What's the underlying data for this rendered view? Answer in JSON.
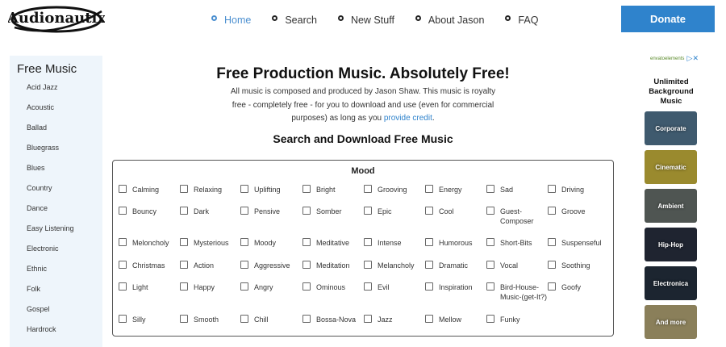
{
  "logo": {
    "text": "Audionautix"
  },
  "nav": {
    "items": [
      {
        "label": "Home",
        "active": true
      },
      {
        "label": "Search",
        "active": false
      },
      {
        "label": "New Stuff",
        "active": false
      },
      {
        "label": "About Jason",
        "active": false
      },
      {
        "label": "FAQ",
        "active": false
      }
    ],
    "donate_label": "Donate"
  },
  "sidebar": {
    "title": "Free Music",
    "items": [
      "Acid Jazz",
      "Acoustic",
      "Ballad",
      "Bluegrass",
      "Blues",
      "Country",
      "Dance",
      "Easy Listening",
      "Electronic",
      "Ethnic",
      "Folk",
      "Gospel",
      "Hardrock"
    ]
  },
  "main": {
    "title": "Free Production Music. Absolutely Free!",
    "desc_before": "All music is composed and produced by Jason Shaw. This music is royalty free - completely free - for you to download and use (even for commercial purposes) as long as you",
    "desc_link": "provide credit",
    "desc_after": ".",
    "section_title": "Search and Download Free Music"
  },
  "mood": {
    "title": "Mood",
    "options": [
      [
        "Calming",
        "Relaxing",
        "Uplifting",
        "Bright",
        "Grooving",
        "Energy",
        "Sad",
        "Driving"
      ],
      [
        "Bouncy",
        "Dark",
        "Pensive",
        "Somber",
        "Epic",
        "Cool",
        "Guest-Composer",
        "Groove"
      ],
      [
        "Meloncholy",
        "Mysterious",
        "Moody",
        "Meditative",
        "Intense",
        "Humorous",
        "Short-Bits",
        "Suspenseful"
      ],
      [
        "Christmas",
        "Action",
        "Aggressive",
        "Meditation",
        "Melancholy",
        "Dramatic",
        "Vocal",
        "Soothing"
      ],
      [
        "Light",
        "Happy",
        "Angry",
        "Ominous",
        "Evil",
        "Inspiration",
        "Bird-House-Music-(get-It?)",
        "Goofy"
      ],
      [
        "Silly",
        "Smooth",
        "Chill",
        "Bossa-Nova",
        "Jazz",
        "Mellow",
        "Funky"
      ]
    ]
  },
  "ad": {
    "brand": "envatoelements",
    "heading": "Unlimited Background Music",
    "tiles": [
      {
        "label": "Corporate",
        "color": "#3f5a6e"
      },
      {
        "label": "Cinematic",
        "color": "#9a8a2e"
      },
      {
        "label": "Ambient",
        "color": "#4f5552"
      },
      {
        "label": "Hip-Hop",
        "color": "#1f2430"
      },
      {
        "label": "Electronica",
        "color": "#1c2530"
      },
      {
        "label": "And more",
        "color": "#8a7f5a"
      }
    ]
  }
}
